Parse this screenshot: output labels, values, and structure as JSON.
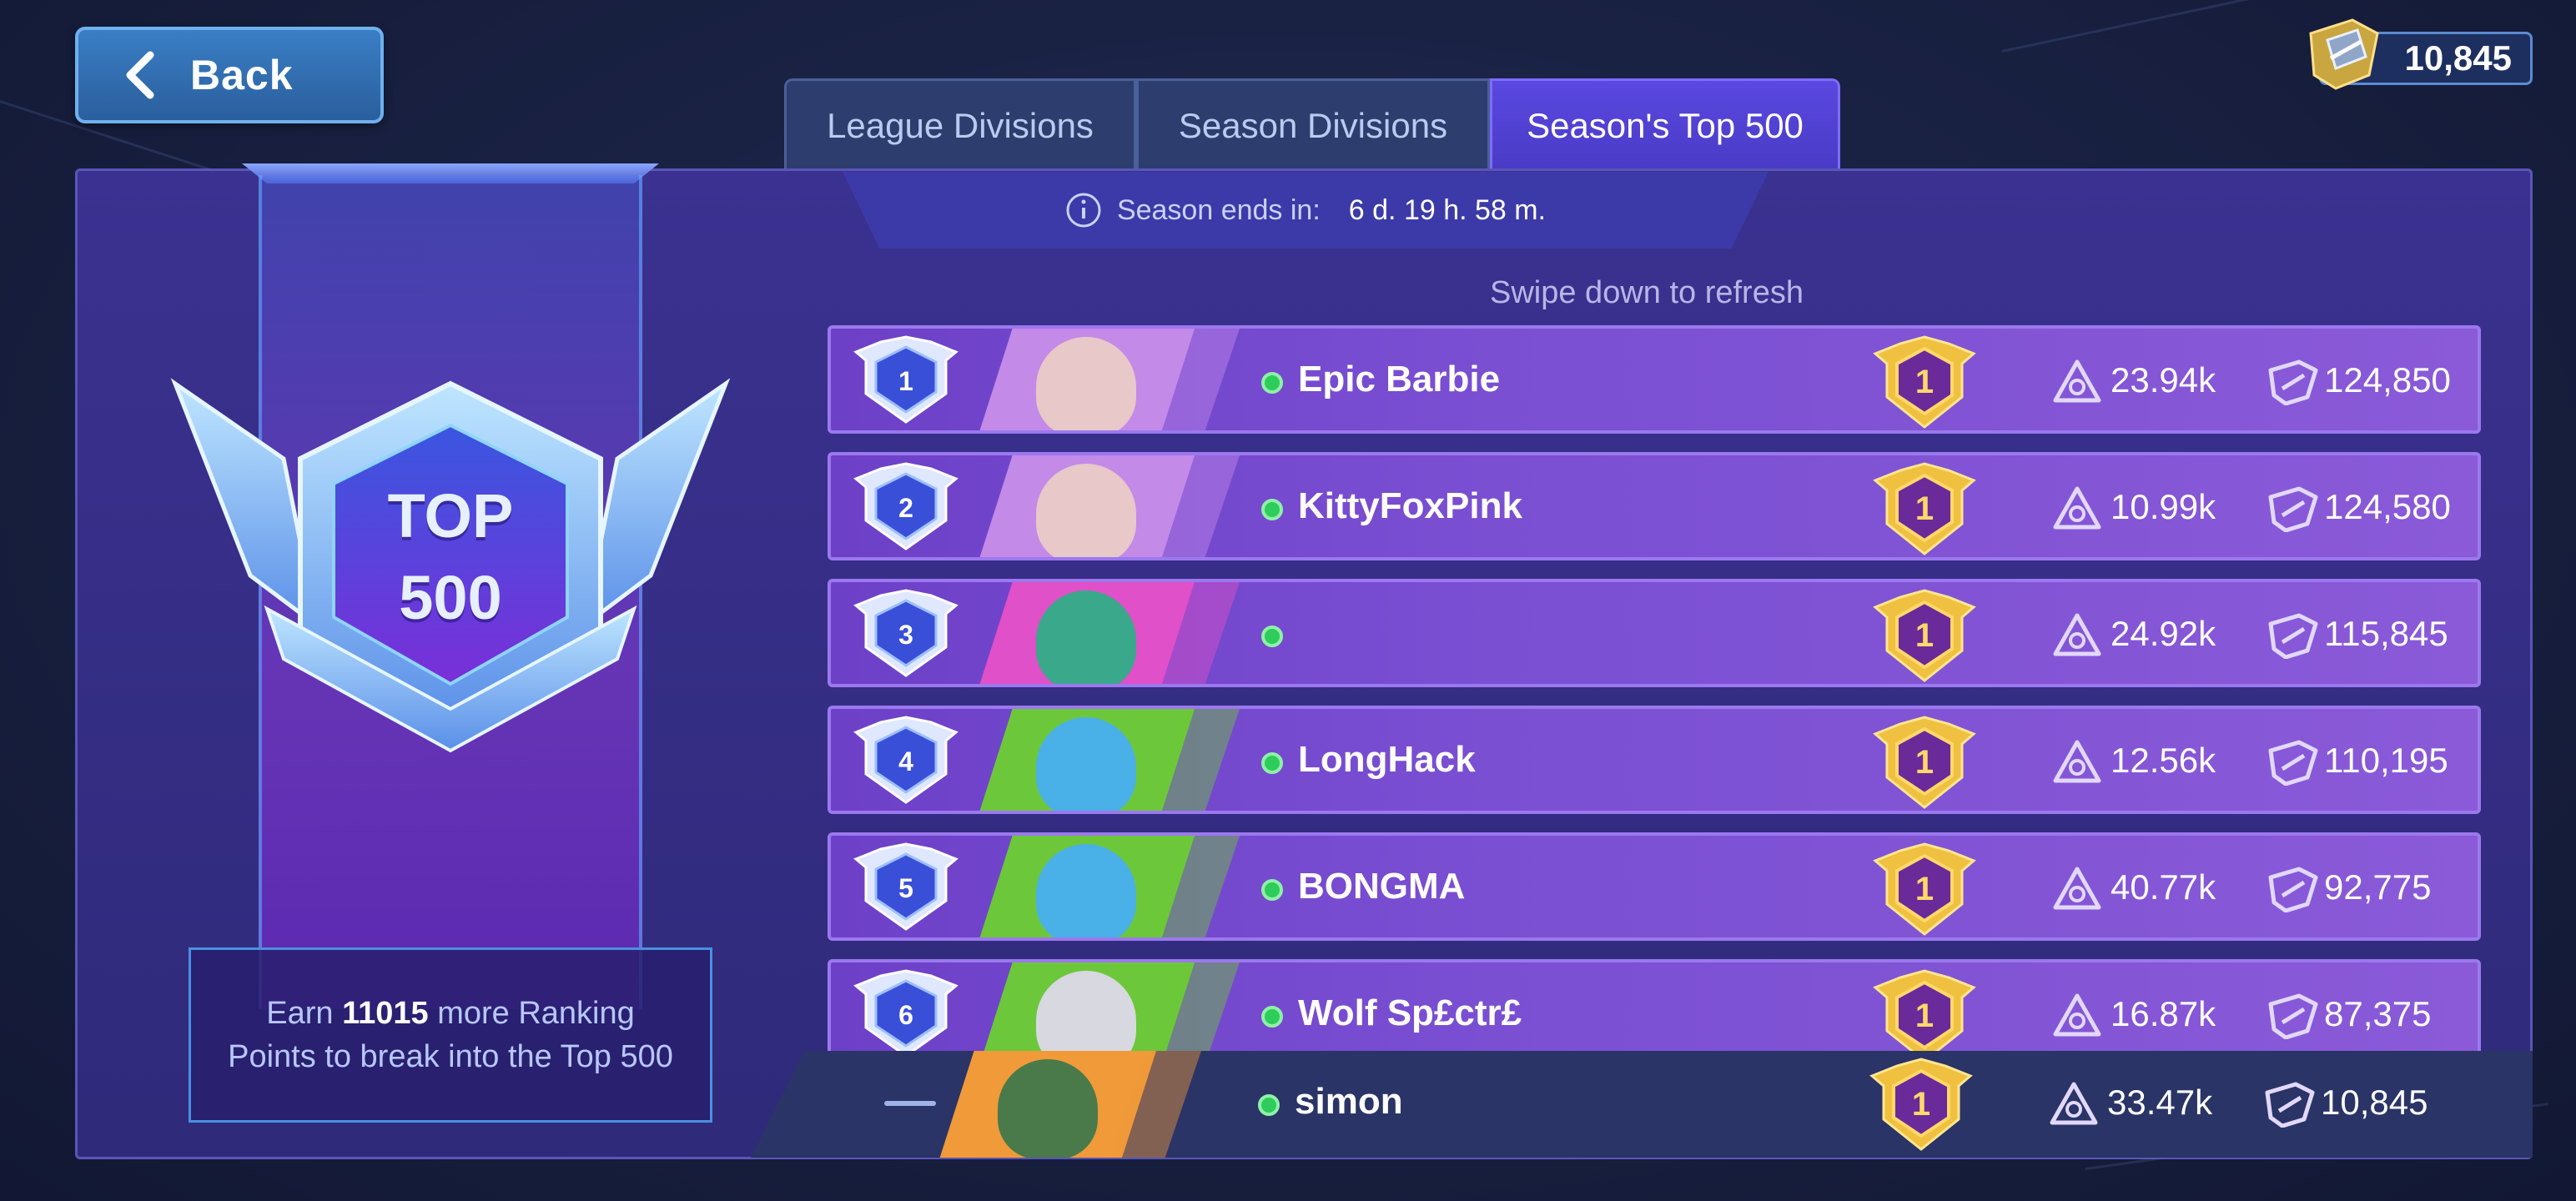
{
  "header": {
    "back_label": "Back",
    "currency_value": "10,845"
  },
  "tabs": [
    {
      "label": "League Divisions",
      "active": false
    },
    {
      "label": "Season Divisions",
      "active": false
    },
    {
      "label": "Season's Top 500",
      "active": true
    }
  ],
  "season": {
    "label": "Season ends in:",
    "time": "6 d. 19 h. 58 m."
  },
  "refresh_hint": "Swipe down to refresh",
  "badge": {
    "line1": "TOP",
    "line2": "500"
  },
  "earn": {
    "prefix": "Earn",
    "points": "11015",
    "suffix": "more Ranking Points to break into the Top 500"
  },
  "players": [
    {
      "rank": "1",
      "name": "Epic Barbie",
      "league": "1",
      "stat1": "23.94k",
      "stat2": "124,850",
      "avatar_color": "#c48ae8",
      "avatar_face": "#e8c8c8"
    },
    {
      "rank": "2",
      "name": "KittyFoxPink",
      "league": "1",
      "stat1": "10.99k",
      "stat2": "124,580",
      "avatar_color": "#c48ae8",
      "avatar_face": "#e8c8c8"
    },
    {
      "rank": "3",
      "name": "",
      "league": "1",
      "stat1": "24.92k",
      "stat2": "115,845",
      "avatar_color": "#e050c8",
      "avatar_face": "#3aa88a"
    },
    {
      "rank": "4",
      "name": "LongHack",
      "league": "1",
      "stat1": "12.56k",
      "stat2": "110,195",
      "avatar_color": "#6cc83a",
      "avatar_face": "#4ab0e8"
    },
    {
      "rank": "5",
      "name": "BONGMA",
      "league": "1",
      "stat1": "40.77k",
      "stat2": "92,775",
      "avatar_color": "#6cc83a",
      "avatar_face": "#4ab0e8"
    },
    {
      "rank": "6",
      "name": "Wolf Sp£ctr£",
      "league": "1",
      "stat1": "16.87k",
      "stat2": "87,375",
      "avatar_color": "#6cc83a",
      "avatar_face": "#d8d8e0"
    }
  ],
  "me": {
    "name": "simon",
    "league": "1",
    "stat1": "33.47k",
    "stat2": "10,845",
    "avatar_color": "#f09a3a",
    "avatar_face": "#4a7a4a"
  }
}
